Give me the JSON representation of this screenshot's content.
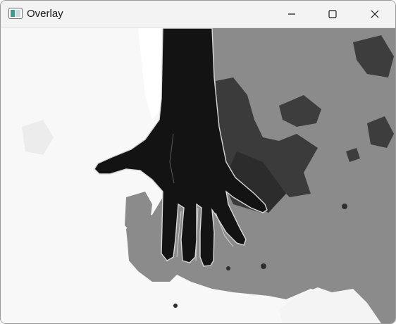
{
  "window": {
    "title": "Overlay"
  },
  "titlebar": {
    "icons": [
      "app-icon",
      "minimize-icon",
      "maximize-icon",
      "close-icon"
    ]
  },
  "image": {
    "description_icon": "hand-segmentation-overlay",
    "colors": {
      "background_light": "#fafafa",
      "region_gray": "#8a8a8a",
      "region_dark_gray": "#3f3f3f",
      "hand": "#141414",
      "hand_edge": "#d8d8d8"
    }
  }
}
